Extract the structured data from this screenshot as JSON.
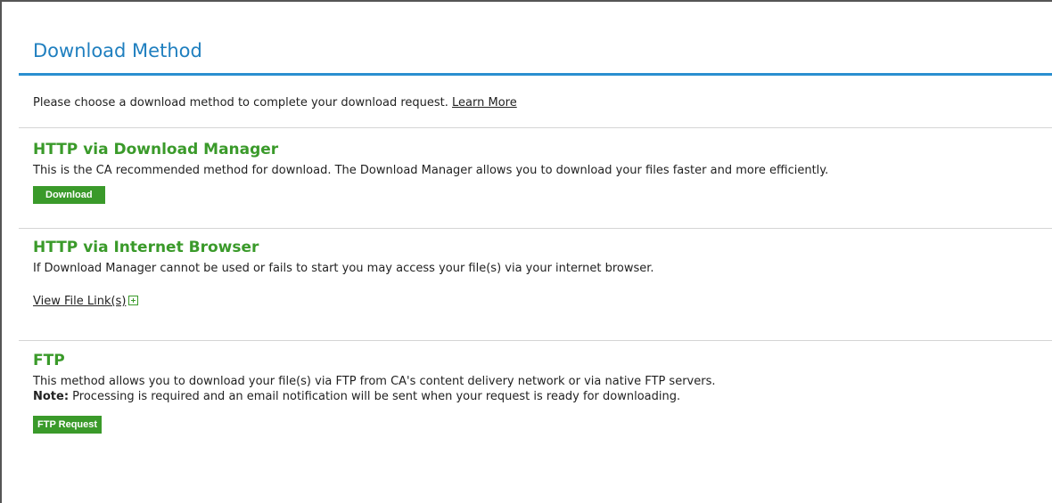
{
  "panel": {
    "title": "Download Method",
    "intro_text": "Please choose a download method to complete your download request.",
    "learn_more_label": "Learn More"
  },
  "sections": {
    "download_manager": {
      "title": "HTTP via Download Manager",
      "description": "This is the CA recommended method for download. The Download Manager allows you to download your files faster and more efficiently.",
      "button_label": "Download"
    },
    "internet_browser": {
      "title": "HTTP via Internet Browser",
      "description": "If Download Manager cannot be used or fails to start you may access your file(s) via your internet browser.",
      "link_label": "View File Link(s)",
      "expand_icon": "plus-box-icon"
    },
    "ftp": {
      "title": "FTP",
      "description": "This method allows you to download your file(s) via FTP from CA's content delivery network or via native FTP servers.",
      "note_label": "Note:",
      "note_text": " Processing is required and an email notification will be sent when your request is ready for downloading.",
      "button_label": "FTP Request"
    }
  },
  "colors": {
    "title_blue": "#1f7fbf",
    "accent_green": "#3a9a2a",
    "rule_blue": "#2a8fd0"
  }
}
